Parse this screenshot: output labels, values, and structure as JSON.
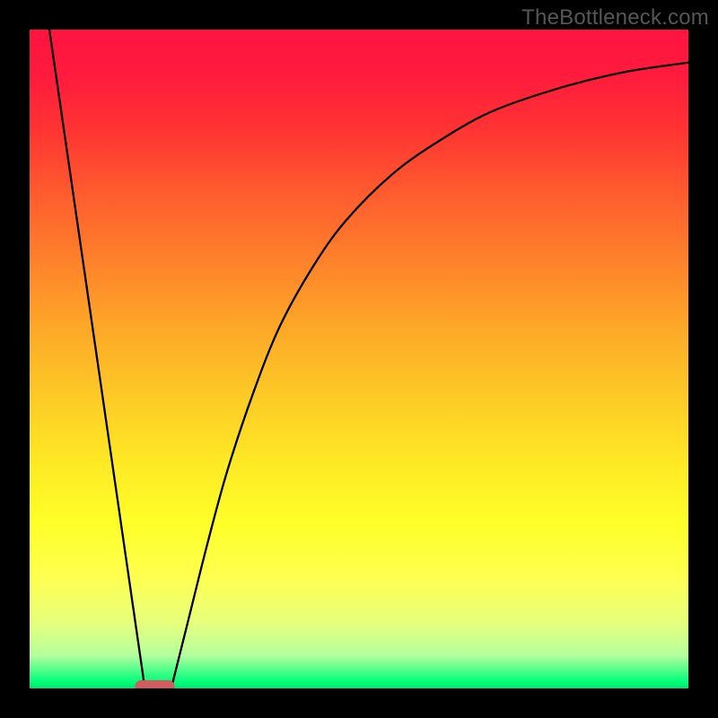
{
  "watermark": "TheBottleneck.com",
  "chart_data": {
    "type": "line",
    "title": "",
    "xlabel": "",
    "ylabel": "",
    "xlim": [
      0,
      100
    ],
    "ylim": [
      0,
      100
    ],
    "background": {
      "type": "vertical_gradient",
      "stops": [
        {
          "offset": 0.0,
          "color": "#ff1440"
        },
        {
          "offset": 0.07,
          "color": "#ff1b3d"
        },
        {
          "offset": 0.15,
          "color": "#ff3333"
        },
        {
          "offset": 0.25,
          "color": "#ff5c2e"
        },
        {
          "offset": 0.35,
          "color": "#fe812b"
        },
        {
          "offset": 0.45,
          "color": "#fda728"
        },
        {
          "offset": 0.55,
          "color": "#fdc826"
        },
        {
          "offset": 0.65,
          "color": "#fee725"
        },
        {
          "offset": 0.75,
          "color": "#feff28"
        },
        {
          "offset": 0.83,
          "color": "#ffff50"
        },
        {
          "offset": 0.9,
          "color": "#e7ff7c"
        },
        {
          "offset": 0.95,
          "color": "#b4ff9e"
        },
        {
          "offset": 0.99,
          "color": "#00ff79"
        },
        {
          "offset": 1.0,
          "color": "#00e572"
        }
      ]
    },
    "series": [
      {
        "name": "left-branch",
        "description": "Steep descending line from top-left toward minimum",
        "points": [
          {
            "x": 3.0,
            "y": 100.0
          },
          {
            "x": 17.5,
            "y": 0.0
          }
        ]
      },
      {
        "name": "right-branch",
        "description": "Rising curve from minimum with decreasing slope toward top-right",
        "points": [
          {
            "x": 21.5,
            "y": 0.0
          },
          {
            "x": 24.0,
            "y": 10.0
          },
          {
            "x": 27.0,
            "y": 22.0
          },
          {
            "x": 30.0,
            "y": 33.0
          },
          {
            "x": 34.0,
            "y": 45.0
          },
          {
            "x": 38.0,
            "y": 55.0
          },
          {
            "x": 43.0,
            "y": 64.0
          },
          {
            "x": 48.0,
            "y": 71.0
          },
          {
            "x": 55.0,
            "y": 78.0
          },
          {
            "x": 62.0,
            "y": 83.0
          },
          {
            "x": 70.0,
            "y": 87.5
          },
          {
            "x": 80.0,
            "y": 91.0
          },
          {
            "x": 90.0,
            "y": 93.5
          },
          {
            "x": 100.0,
            "y": 95.0
          }
        ]
      }
    ],
    "marker": {
      "name": "minimum-pill",
      "shape": "rounded-rect",
      "x": 19.0,
      "y": 0.0,
      "width": 6.0,
      "height": 2.5,
      "color": "#cf5d60"
    }
  }
}
